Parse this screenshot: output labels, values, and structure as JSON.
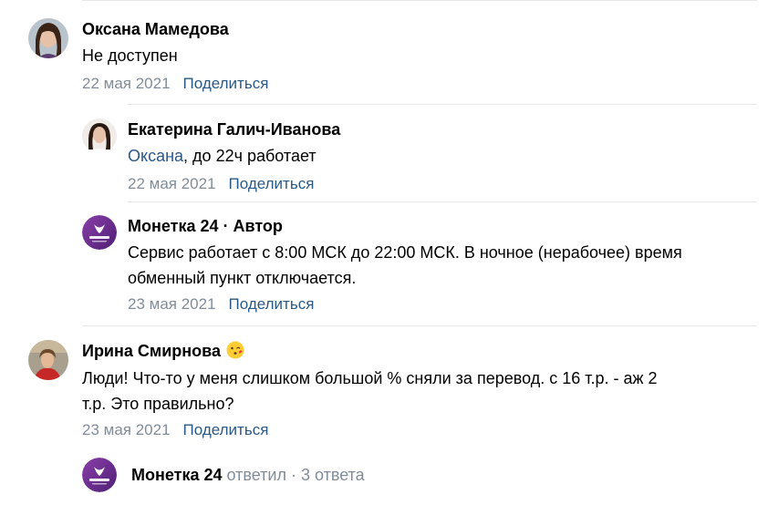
{
  "comments": [
    {
      "author": "Оксана Мамедова",
      "text": "Не доступен",
      "date": "22 мая 2021",
      "share": "Поделиться"
    },
    {
      "author": "Екатерина Галич-Иванова",
      "mention": "Оксана",
      "text_rest": ", до 22ч работает",
      "date": "22 мая 2021",
      "share": "Поделиться"
    },
    {
      "author": "Монетка 24",
      "author_sep": " · ",
      "author_badge": "Автор",
      "text_line1": "Сервис работает с 8:00 МСК до 22:00 МСК. В ночное (нерабочее) время",
      "text_line2": "обменный пункт отключается.",
      "date": "23 мая 2021",
      "share": "Поделиться"
    },
    {
      "author": "Ирина Смирнова",
      "emoji": "kissing-face-emoji",
      "text_line1": "Люди! Что-то у меня слишком большой % сняли за перевод. с 16 т.р. - аж 2",
      "text_line2": "т.р. Это правильно?",
      "date": "23 мая 2021",
      "share": "Поделиться"
    }
  ],
  "replies_summary": {
    "name": "Монетка 24",
    "action": "ответил",
    "dot": "·",
    "count": "3 ответа"
  },
  "colors": {
    "link": "#2a5885",
    "meta": "#818c99",
    "divider": "#e7e8ec",
    "brand_purple": "#6a2a8c"
  }
}
